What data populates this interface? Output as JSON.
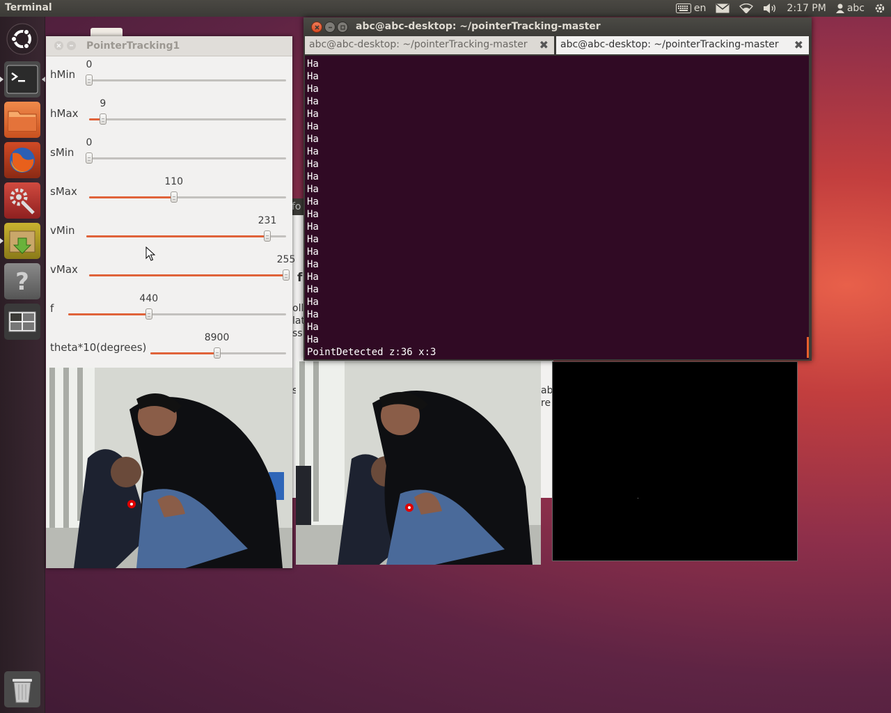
{
  "top_panel": {
    "app_title": "Terminal",
    "keyboard_layout": "en",
    "clock": "2:17 PM",
    "user": "abc",
    "icons": [
      "keyboard-icon",
      "mail-icon",
      "wifi-icon",
      "volume-icon",
      "user-icon",
      "power-gear-icon"
    ]
  },
  "launcher": {
    "items": [
      "dash-home",
      "terminal",
      "files",
      "firefox",
      "system-settings",
      "archive-manager",
      "help",
      "workspace-switcher",
      "trash"
    ]
  },
  "pointer_window": {
    "title": "PointerTracking1",
    "sliders": [
      {
        "label": "hMin",
        "value": "0",
        "fraction": 0.0
      },
      {
        "label": "hMax",
        "value": "9",
        "fraction": 0.07
      },
      {
        "label": "sMin",
        "value": "0",
        "fraction": 0.0
      },
      {
        "label": "sMax",
        "value": "110",
        "fraction": 0.43
      },
      {
        "label": "vMin",
        "value": "231",
        "fraction": 0.906
      },
      {
        "label": "vMax",
        "value": "255",
        "fraction": 1.0
      },
      {
        "label": "f",
        "value": "440",
        "fraction": 0.37
      },
      {
        "label": "theta*10(degrees)",
        "value": "8900",
        "fraction": 0.49
      }
    ]
  },
  "terminal": {
    "title": "abc@abc-desktop: ~/pointerTracking-master",
    "tabs": [
      {
        "label": "abc@abc-desktop: ~/pointerTracking-master",
        "active": false
      },
      {
        "label": "abc@abc-desktop: ~/pointerTracking-master",
        "active": true
      }
    ],
    "lines": [
      "Ha",
      "Ha",
      "Ha",
      "Ha",
      "Ha",
      "Ha",
      "Ha",
      "Ha",
      "Ha",
      "Ha",
      "Ha",
      "Ha",
      "Ha",
      "Ha",
      "Ha",
      "Ha",
      "Ha",
      "Ha",
      "Ha",
      "Ha",
      "Ha",
      "Ha",
      "Ha",
      "PointDetected z:36 x:3"
    ]
  },
  "background_window": {
    "fragments": [
      "fo",
      "f",
      "ollo",
      "lat",
      "ss",
      "s",
      "ab",
      "re"
    ]
  },
  "colors": {
    "slider_accent": "#e0633a",
    "terminal_bg": "#300a24",
    "panel_bg": "#3c3b37"
  }
}
